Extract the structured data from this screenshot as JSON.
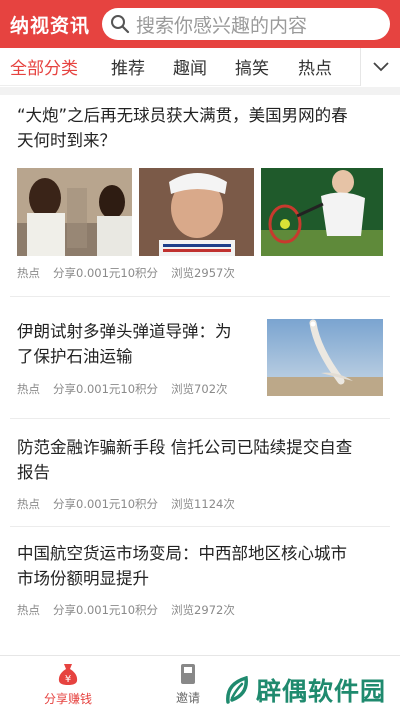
{
  "header": {
    "brand": "纳视资讯",
    "search_placeholder": "搜索你感兴趣的内容",
    "accent": "#e64340"
  },
  "tabs": [
    {
      "label": "全部分类",
      "active": true
    },
    {
      "label": "推荐"
    },
    {
      "label": "趣闻"
    },
    {
      "label": "搞笑"
    },
    {
      "label": "热点"
    }
  ],
  "articles": [
    {
      "title_line1": "“大炮”之后再无球员获大满贯，美国男网的春",
      "title_line2": "天何时到来？",
      "tag": "热点",
      "share": "分享0.001元10积分",
      "views": "浏览2957次"
    },
    {
      "title_line1": "伊朗试射多弹头弹道导弹：为",
      "title_line2": "了保护石油运输",
      "tag": "热点",
      "share": "分享0.001元10积分",
      "views": "浏览702次"
    },
    {
      "title_line1": "防范金融诈骗新手段 信托公司已陆续提交自查",
      "title_line2": "报告",
      "tag": "热点",
      "share": "分享0.001元10积分",
      "views": "浏览1124次"
    },
    {
      "title_line1": "中国航空货运市场变局：中西部地区核心城市",
      "title_line2": "市场份额明显提升",
      "tag": "热点",
      "share": "分享0.001元10积分",
      "views": "浏览2972次"
    }
  ],
  "bottom_nav": [
    {
      "label": "分享赚钱",
      "icon": "money-bag-icon",
      "active": true
    },
    {
      "label": "邀请",
      "icon": "invite-icon"
    }
  ],
  "watermark": {
    "text": "辟偶软件园",
    "color": "#1f8a6e"
  }
}
